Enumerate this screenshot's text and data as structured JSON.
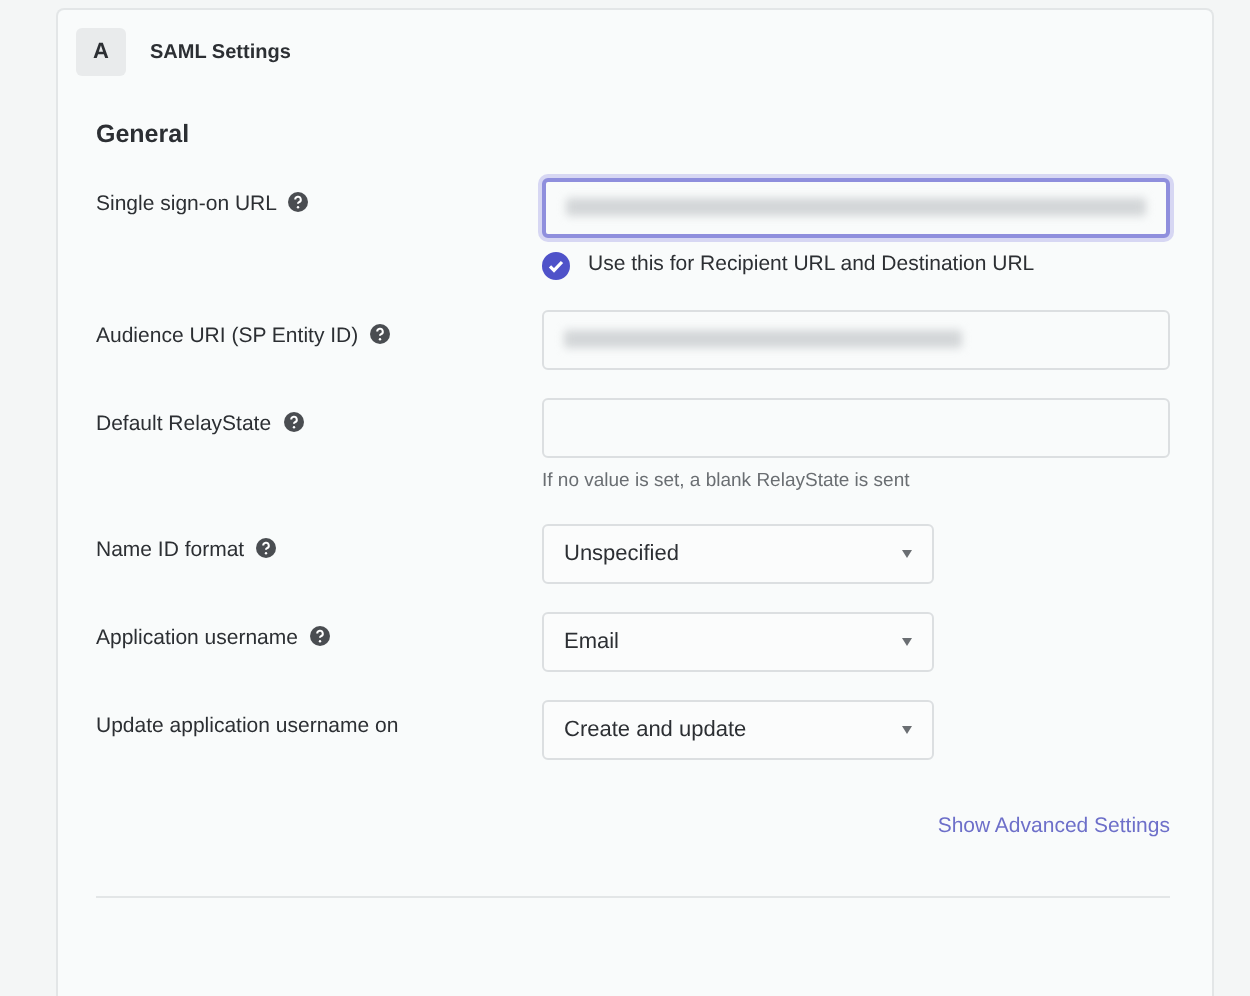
{
  "panel": {
    "badge": "A",
    "title": "SAML Settings"
  },
  "section": "General",
  "fields": [
    {
      "kind": "text",
      "label": "Single sign-on URL",
      "help_icon": true,
      "redacted": true,
      "focused": true,
      "checkbox": {
        "label": "Use this for Recipient URL and Destination URL",
        "checked": true
      }
    },
    {
      "kind": "text",
      "label": "Audience URI (SP Entity ID)",
      "help_icon": true,
      "redacted": true,
      "focused": false
    },
    {
      "kind": "text",
      "label": "Default RelayState",
      "help_icon": true,
      "redacted": false,
      "focused": false,
      "hint": "If no value is set, a blank RelayState is sent"
    },
    {
      "kind": "select",
      "label": "Name ID format",
      "help_icon": true,
      "value": "Unspecified"
    },
    {
      "kind": "select",
      "label": "Application username",
      "help_icon": true,
      "value": "Email"
    },
    {
      "kind": "select",
      "label": "Update application username on",
      "help_icon": false,
      "value": "Create and update"
    }
  ],
  "advanced_link": "Show Advanced Settings"
}
